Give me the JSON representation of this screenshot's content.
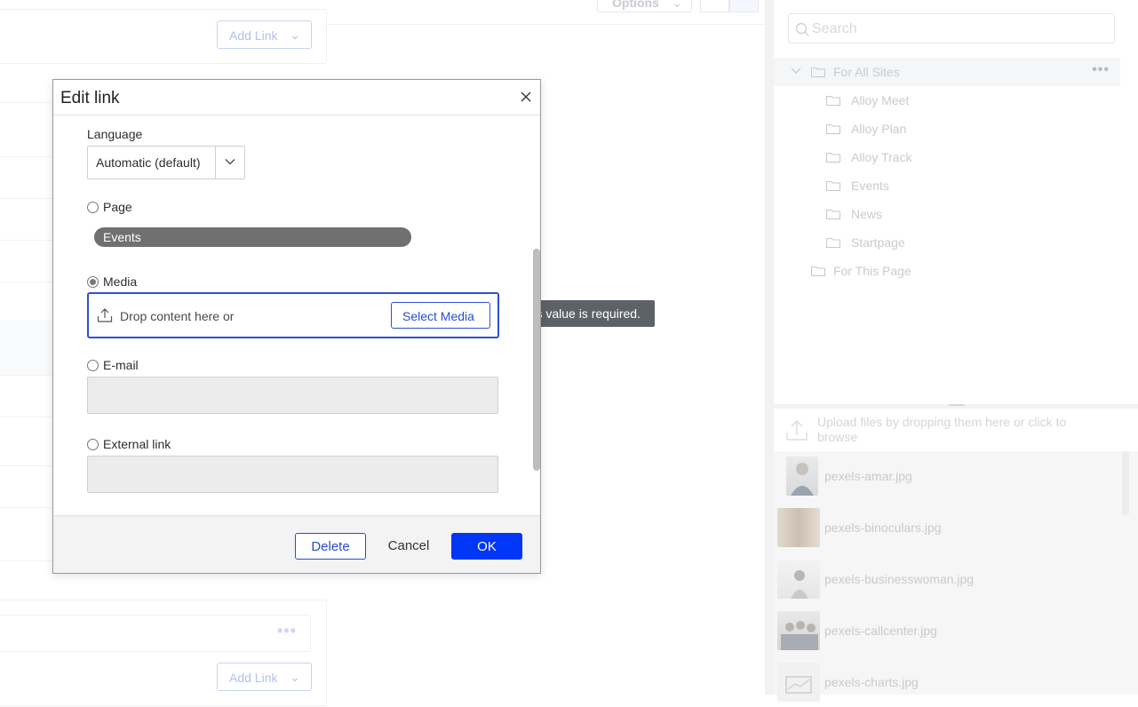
{
  "background": {
    "toolbar": {
      "options_label": "Options"
    },
    "add_link_label": "Add Link"
  },
  "assets_panel": {
    "search": {
      "placeholder": "Search"
    },
    "tree": {
      "for_all_sites": "For All Sites",
      "children": [
        "Alloy Meet",
        "Alloy Plan",
        "Alloy Track",
        "Events",
        "News",
        "Startpage"
      ],
      "for_this_page": "For This Page"
    },
    "upload_text": "Upload files by dropping them here or click to browse",
    "media_files": [
      "pexels-amar.jpg",
      "pexels-binoculars.jpg",
      "pexels-businesswoman.jpg",
      "pexels-callcenter.jpg",
      "pexels-charts.jpg"
    ]
  },
  "dialog": {
    "title": "Edit link",
    "language": {
      "label": "Language",
      "value": "Automatic (default)"
    },
    "page": {
      "label": "Page",
      "selected": "Events",
      "checked": false
    },
    "media": {
      "label": "Media",
      "checked": true,
      "drop_text": "Drop content here or",
      "select_button": "Select Media",
      "validation_message": "This value is required."
    },
    "email": {
      "label": "E-mail",
      "value": "",
      "checked": false
    },
    "external_link": {
      "label": "External link",
      "value": "",
      "checked": false
    },
    "buttons": {
      "delete": "Delete",
      "cancel": "Cancel",
      "ok": "OK"
    }
  },
  "colors": {
    "primary": "#0036f5",
    "outline_blue": "#2a4bd3",
    "tooltip_bg": "#5d6168",
    "pill_bg": "#707070"
  }
}
